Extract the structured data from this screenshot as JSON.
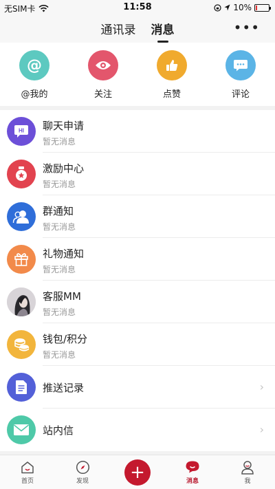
{
  "status": {
    "carrier": "无SIM卡",
    "time": "11:58",
    "battery_percent": "10%",
    "battery_level": 0.1,
    "battery_color": "#e33333"
  },
  "header": {
    "tabs": [
      {
        "label": "通讯录",
        "active": false
      },
      {
        "label": "消息",
        "active": true
      }
    ],
    "more_icon": "more-dots-icon"
  },
  "quick": [
    {
      "label": "@我的",
      "icon": "at-icon",
      "color": "#5dc9c0"
    },
    {
      "label": "关注",
      "icon": "eye-icon",
      "color": "#e3566c"
    },
    {
      "label": "点赞",
      "icon": "thumbs-up-icon",
      "color": "#f0aa2e"
    },
    {
      "label": "评论",
      "icon": "comment-icon",
      "color": "#5bb4e6"
    }
  ],
  "list": [
    {
      "title": "聊天申请",
      "sub": "暂无消息",
      "icon": "hi-chat-icon",
      "color": "#6c4fd8"
    },
    {
      "title": "激励中心",
      "sub": "暂无消息",
      "icon": "reward-icon",
      "color": "#e2434f"
    },
    {
      "title": "群通知",
      "sub": "暂无消息",
      "icon": "group-icon",
      "color": "#2f6ed9"
    },
    {
      "title": "礼物通知",
      "sub": "暂无消息",
      "icon": "gift-icon",
      "color": "#f28a4a"
    },
    {
      "title": "客服MM",
      "sub": "暂无消息",
      "icon": "user-photo-avatar",
      "color": "#8a7f88"
    },
    {
      "title": "钱包/积分",
      "sub": "暂无消息",
      "icon": "coins-icon",
      "color": "#f2b53c"
    },
    {
      "title": "推送记录",
      "sub": "",
      "icon": "document-icon",
      "color": "#5360d8",
      "chevron": "›"
    },
    {
      "title": "站内信",
      "sub": "",
      "icon": "mail-icon",
      "color": "#4ec9a8",
      "chevron": "›"
    }
  ],
  "bottom_nav": [
    {
      "label": "首页",
      "icon": "home-icon"
    },
    {
      "label": "发现",
      "icon": "discover-icon"
    },
    {
      "label": "",
      "icon": "plus-icon"
    },
    {
      "label": "消息",
      "icon": "message-icon",
      "active": true
    },
    {
      "label": "我",
      "icon": "profile-icon"
    }
  ],
  "accent_color": "#c4192e"
}
